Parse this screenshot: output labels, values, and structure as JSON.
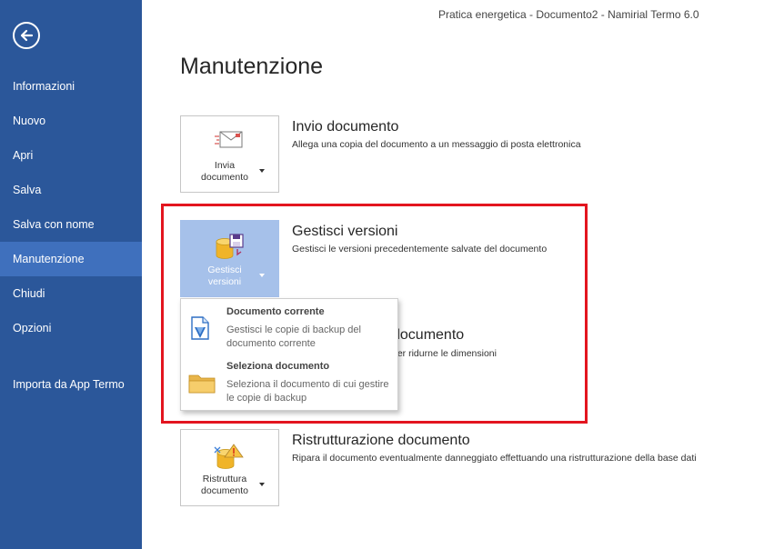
{
  "window": {
    "title": "Pratica energetica - Documento2 - Namirial Termo 6.0"
  },
  "sidebar": {
    "items": [
      {
        "label": "Informazioni"
      },
      {
        "label": "Nuovo"
      },
      {
        "label": "Apri"
      },
      {
        "label": "Salva"
      },
      {
        "label": "Salva con nome"
      },
      {
        "label": "Manutenzione",
        "active": true
      },
      {
        "label": "Chiudi"
      },
      {
        "label": "Opzioni"
      },
      {
        "label": "Importa da App Termo"
      }
    ]
  },
  "main": {
    "title": "Manutenzione",
    "sections": [
      {
        "button_label": "Invia\ndocumento",
        "icon": "email-document-icon",
        "title": "Invio documento",
        "description": "Allega una copia del documento a un messaggio di posta elettronica"
      },
      {
        "button_label": "Gestisci\nversioni",
        "icon": "manage-versions-icon",
        "title": "Gestisci versioni",
        "description": "Gestisci le versioni precedentemente salvate del documento"
      },
      {
        "title": "documento",
        "description": "per ridurne le dimensioni"
      },
      {
        "button_label": "Ristruttura\ndocumento",
        "icon": "restructure-database-icon",
        "title": "Ristrutturazione documento",
        "description": "Ripara il documento eventualmente danneggiato effettuando una ristrutturazione della base dati"
      }
    ]
  },
  "dropdown": {
    "items": [
      {
        "title": "Documento corrente",
        "description": "Gestisci le copie di backup del documento corrente",
        "icon": "current-document-icon"
      },
      {
        "title": "Seleziona documento",
        "description": "Seleziona il documento di cui gestire le copie di backup",
        "icon": "folder-icon"
      }
    ]
  },
  "colors": {
    "sidebar": "#2b579a",
    "sidebar_active": "#3f70bd",
    "button_selected": "#a6c1ea",
    "highlight_border": "#e3151f"
  }
}
